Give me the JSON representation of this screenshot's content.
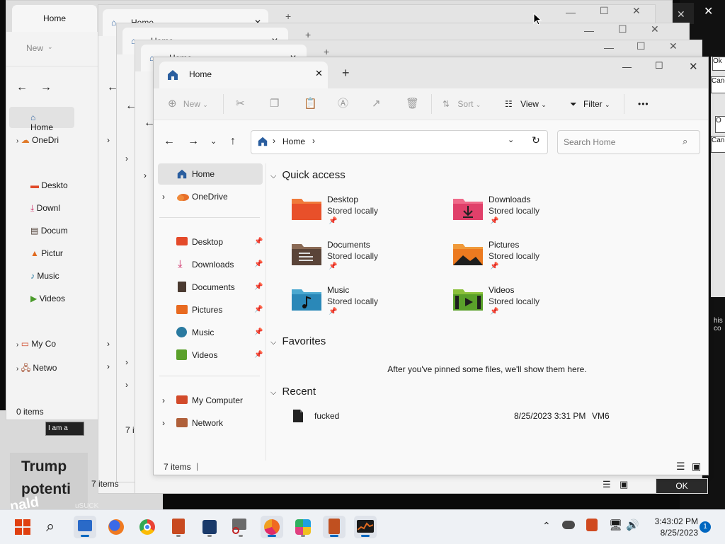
{
  "windows_behind": [
    {
      "tab_title": "Home",
      "toolbar_new": "New",
      "status": "0 items",
      "sidebar": [
        "Home",
        "OneDri",
        "Deskto",
        "Downl",
        "Docum",
        "Pictur",
        "Music",
        "Videos",
        "My Co",
        "Netwo"
      ]
    },
    {
      "tab_title": "Home"
    },
    {
      "tab_title": "Home"
    },
    {
      "tab_title": "Home",
      "status": "7 items"
    }
  ],
  "main_window": {
    "tab_title": "Home",
    "toolbar": {
      "new": "New",
      "sort": "Sort",
      "view": "View",
      "filter": "Filter",
      "more": "•••"
    },
    "breadcrumb": {
      "root": "Home"
    },
    "search_placeholder": "Search Home",
    "sidebar": {
      "home": "Home",
      "onedrive": "OneDrive",
      "pinned": [
        {
          "label": "Desktop",
          "icon": "desktop-icon"
        },
        {
          "label": "Downloads",
          "icon": "downloads-icon"
        },
        {
          "label": "Documents",
          "icon": "documents-icon"
        },
        {
          "label": "Pictures",
          "icon": "pictures-icon"
        },
        {
          "label": "Music",
          "icon": "music-icon"
        },
        {
          "label": "Videos",
          "icon": "videos-icon"
        }
      ],
      "my_computer": "My Computer",
      "network": "Network"
    },
    "quick_access": {
      "title": "Quick access",
      "items": [
        {
          "name": "Desktop",
          "status": "Stored locally",
          "icon": "desktop-folder-icon"
        },
        {
          "name": "Downloads",
          "status": "Stored locally",
          "icon": "downloads-folder-icon"
        },
        {
          "name": "Documents",
          "status": "Stored locally",
          "icon": "documents-folder-icon"
        },
        {
          "name": "Pictures",
          "status": "Stored locally",
          "icon": "pictures-folder-icon"
        },
        {
          "name": "Music",
          "status": "Stored locally",
          "icon": "music-folder-icon"
        },
        {
          "name": "Videos",
          "status": "Stored locally",
          "icon": "videos-folder-icon"
        }
      ]
    },
    "favorites": {
      "title": "Favorites",
      "empty_message": "After you've pinned some files, we'll show them here."
    },
    "recent": {
      "title": "Recent",
      "files": [
        {
          "name": "fucked",
          "date": "8/25/2023 3:31 PM",
          "location": "VM6"
        }
      ]
    },
    "status": "7 items"
  },
  "background_fragments": {
    "right_buttons": [
      "Ok",
      "Canc",
      "O",
      "Can"
    ],
    "right_text": "his co",
    "ok_button": "OK",
    "tooltip_input": "I am a",
    "news_text_1": "Trump",
    "news_text_2": "potenti",
    "news_text_3": "nald",
    "suck_text": "uSUCK",
    "seven_items": "7 ite"
  },
  "taskbar": {
    "clock_time": "3:43:02 PM",
    "clock_date": "8/25/2023",
    "notification_count": "1",
    "apps": [
      "start",
      "search",
      "file-explorer",
      "firefox",
      "chrome",
      "notepad",
      "media-player",
      "magnifier",
      "edge",
      "paint",
      "calculator",
      "task-manager"
    ]
  },
  "colors": {
    "accent": "#0067c0",
    "folder_orange": "#f0a030"
  }
}
